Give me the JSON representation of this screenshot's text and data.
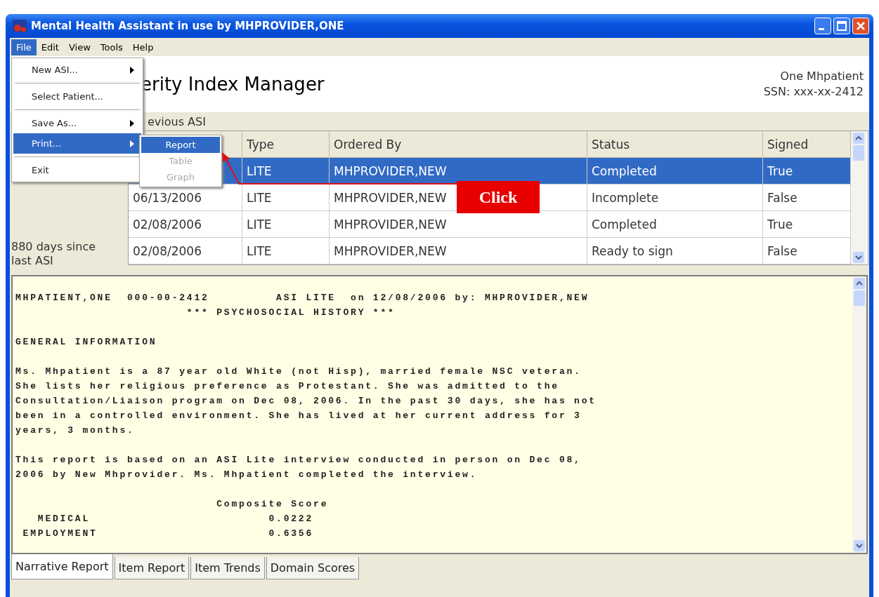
{
  "window": {
    "title": "Mental Health Assistant in use by MHPROVIDER,ONE"
  },
  "menu_bar": [
    {
      "label": "File",
      "selected": true
    },
    {
      "label": "Edit",
      "selected": false
    },
    {
      "label": "View",
      "selected": false
    },
    {
      "label": "Tools",
      "selected": false
    },
    {
      "label": "Help",
      "selected": false
    }
  ],
  "file_menu": [
    {
      "kind": "item",
      "label": "New ASI...",
      "submenu": true,
      "selected": false
    },
    {
      "kind": "separator"
    },
    {
      "kind": "item",
      "label": "Select Patient...",
      "submenu": false,
      "selected": false
    },
    {
      "kind": "separator"
    },
    {
      "kind": "item",
      "label": "Save As...",
      "submenu": true,
      "selected": false
    },
    {
      "kind": "item",
      "label": "Print...",
      "submenu": true,
      "selected": true
    },
    {
      "kind": "separator"
    },
    {
      "kind": "item",
      "label": "Exit",
      "submenu": false,
      "selected": false
    }
  ],
  "print_submenu": [
    {
      "label": "Report",
      "selected": true,
      "disabled": false
    },
    {
      "label": "Table",
      "selected": false,
      "disabled": true
    },
    {
      "label": "Graph",
      "selected": false,
      "disabled": true
    }
  ],
  "header": {
    "title": "erity Index Manager",
    "patient_name": "One Mhpatient",
    "ssn": "SSN: xxx-xx-2412"
  },
  "previous_asi": {
    "label": "evious ASI",
    "days_since": "880 days since last ASI",
    "columns": [
      "Type",
      "Ordered By",
      "Status",
      "Signed"
    ],
    "rows": [
      {
        "type": "LITE",
        "ordered_by": "MHPROVIDER,NEW",
        "status": "Completed",
        "signed": "True",
        "selected": true
      },
      {
        "date": "06/13/2006",
        "type": "LITE",
        "ordered_by": "MHPROVIDER,NEW",
        "status": "Incomplete",
        "signed": "False",
        "selected": false
      },
      {
        "date": "02/08/2006",
        "type": "LITE",
        "ordered_by": "MHPROVIDER,NEW",
        "status": "Completed",
        "signed": "True",
        "selected": false
      },
      {
        "date": "02/08/2006",
        "type": "LITE",
        "ordered_by": "MHPROVIDER,NEW",
        "status": "Ready to sign",
        "signed": "False",
        "selected": false
      }
    ]
  },
  "callout": {
    "label": "Click"
  },
  "report": {
    "blocks": [
      "MHPATIENT,ONE  000-00-2412         ASI LITE  on 12/08/2006 by: MHPROVIDER,NEW\n                       *** PSYCHOSOCIAL HISTORY ***",
      "GENERAL INFORMATION",
      "Ms. Mhpatient is a 87 year old White (not Hisp), married female NSC veteran.\nShe lists her religious preference as Protestant. She was admitted to the\nConsultation/Liaison program on Dec 08, 2006. In the past 30 days, she has not\nbeen in a controlled environment. She has lived at her current address for 3\nyears, 3 months.",
      "This report is based on an ASI Lite interview conducted in person on Dec 08,\n2006 by New Mhprovider. Ms. Mhpatient completed the interview.",
      "                           Composite Score\n   MEDICAL                        0.0222\n EMPLOYMENT                       0.6356"
    ]
  },
  "tabs": [
    {
      "label": "Narrative Report",
      "selected": true
    },
    {
      "label": "Item Report",
      "selected": false
    },
    {
      "label": "Item Trends",
      "selected": false
    },
    {
      "label": "Domain Scores",
      "selected": false
    }
  ]
}
